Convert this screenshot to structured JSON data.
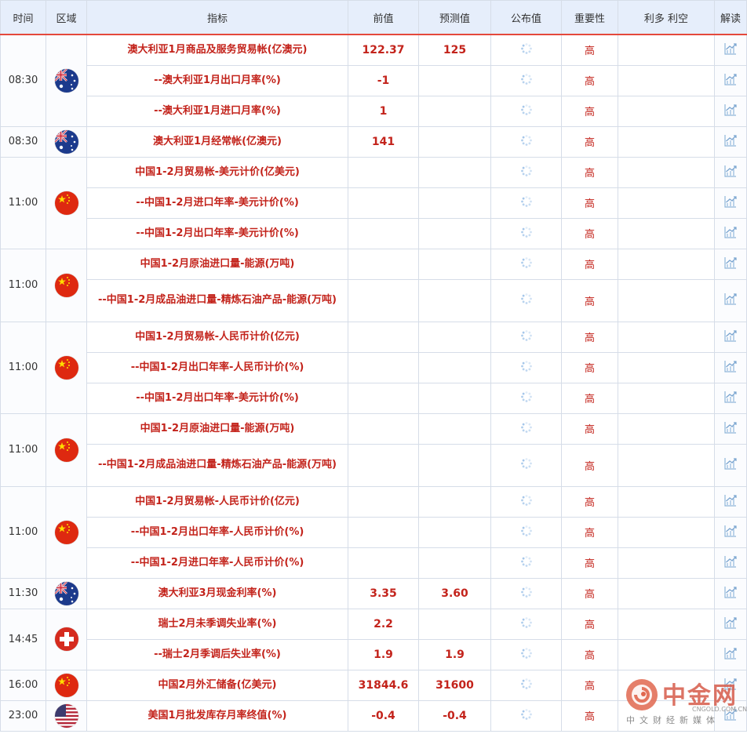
{
  "headers": {
    "time": "时间",
    "region": "区域",
    "indicator": "指标",
    "previous": "前值",
    "forecast": "预测值",
    "actual": "公布值",
    "importance": "重要性",
    "impact": "利多 利空",
    "interpret": "解读"
  },
  "groups": [
    {
      "time": "08:30",
      "flag": "australia-flag",
      "rows": [
        {
          "indicator": "澳大利亚1月商品及服务贸易帐(亿澳元)",
          "previous": "122.37",
          "forecast": "125",
          "importance": "高"
        },
        {
          "indicator": "--澳大利亚1月出口月率(%)",
          "previous": "-1",
          "forecast": "",
          "importance": "高"
        },
        {
          "indicator": "--澳大利亚1月进口月率(%)",
          "previous": "1",
          "forecast": "",
          "importance": "高"
        }
      ]
    },
    {
      "time": "08:30",
      "flag": "australia-flag",
      "rows": [
        {
          "indicator": "澳大利亚1月经常帐(亿澳元)",
          "previous": "141",
          "forecast": "",
          "importance": "高"
        }
      ]
    },
    {
      "time": "11:00",
      "flag": "china-flag",
      "rows": [
        {
          "indicator": "中国1-2月贸易帐-美元计价(亿美元)",
          "previous": "",
          "forecast": "",
          "importance": "高"
        },
        {
          "indicator": "--中国1-2月进口年率-美元计价(%)",
          "previous": "",
          "forecast": "",
          "importance": "高"
        },
        {
          "indicator": "--中国1-2月出口年率-美元计价(%)",
          "previous": "",
          "forecast": "",
          "importance": "高"
        }
      ]
    },
    {
      "time": "11:00",
      "flag": "china-flag",
      "rows": [
        {
          "indicator": "中国1-2月原油进口量-能源(万吨)",
          "previous": "",
          "forecast": "",
          "importance": "高"
        },
        {
          "indicator": "--中国1-2月成品油进口量-精炼石油产品-能源(万吨)",
          "previous": "",
          "forecast": "",
          "importance": "高"
        }
      ]
    },
    {
      "time": "11:00",
      "flag": "china-flag",
      "rows": [
        {
          "indicator": "中国1-2月贸易帐-人民币计价(亿元)",
          "previous": "",
          "forecast": "",
          "importance": "高"
        },
        {
          "indicator": "--中国1-2月出口年率-人民币计价(%)",
          "previous": "",
          "forecast": "",
          "importance": "高"
        },
        {
          "indicator": "--中国1-2月出口年率-美元计价(%)",
          "previous": "",
          "forecast": "",
          "importance": "高"
        }
      ]
    },
    {
      "time": "11:00",
      "flag": "china-flag",
      "rows": [
        {
          "indicator": "中国1-2月原油进口量-能源(万吨)",
          "previous": "",
          "forecast": "",
          "importance": "高"
        },
        {
          "indicator": "--中国1-2月成品油进口量-精炼石油产品-能源(万吨)",
          "previous": "",
          "forecast": "",
          "importance": "高"
        }
      ]
    },
    {
      "time": "11:00",
      "flag": "china-flag",
      "rows": [
        {
          "indicator": "中国1-2月贸易帐-人民币计价(亿元)",
          "previous": "",
          "forecast": "",
          "importance": "高"
        },
        {
          "indicator": "--中国1-2月出口年率-人民币计价(%)",
          "previous": "",
          "forecast": "",
          "importance": "高"
        },
        {
          "indicator": "--中国1-2月进口年率-人民币计价(%)",
          "previous": "",
          "forecast": "",
          "importance": "高"
        }
      ]
    },
    {
      "time": "11:30",
      "flag": "australia-flag",
      "rows": [
        {
          "indicator": "澳大利亚3月现金利率(%)",
          "previous": "3.35",
          "forecast": "3.60",
          "importance": "高"
        }
      ]
    },
    {
      "time": "14:45",
      "flag": "switzerland-flag",
      "rows": [
        {
          "indicator": "瑞士2月未季调失业率(%)",
          "previous": "2.2",
          "forecast": "",
          "importance": "高"
        },
        {
          "indicator": "--瑞士2月季调后失业率(%)",
          "previous": "1.9",
          "forecast": "1.9",
          "importance": "高"
        }
      ]
    },
    {
      "time": "16:00",
      "flag": "china-flag",
      "rows": [
        {
          "indicator": "中国2月外汇储备(亿美元)",
          "previous": "31844.6",
          "forecast": "31600",
          "importance": "高"
        }
      ]
    },
    {
      "time": "23:00",
      "flag": "usa-flag",
      "rows": [
        {
          "indicator": "美国1月批发库存月率终值(%)",
          "previous": "-0.4",
          "forecast": "-0.4",
          "importance": "高"
        }
      ]
    }
  ],
  "watermark": {
    "title": "中金网",
    "site": "CNGOLD.COM.CN",
    "subtitle": "中文财经新媒体"
  },
  "colors": {
    "accent": "#e4483b",
    "value_text": "#c3231b",
    "header_bg": "#e6eefb",
    "border": "#d6dde8"
  }
}
